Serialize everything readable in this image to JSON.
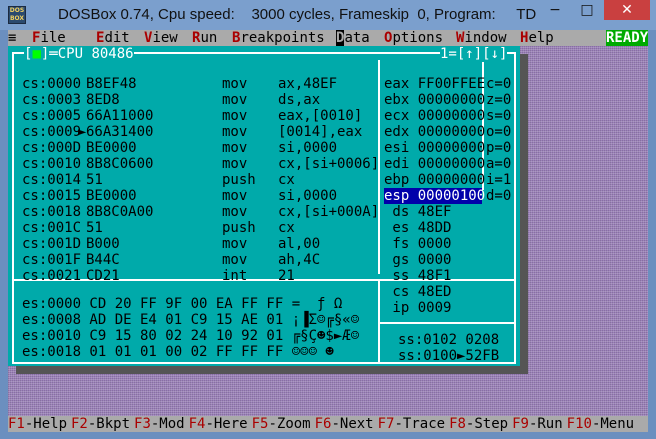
{
  "title": "DOSBox 0.74, Cpu speed:    3000 cycles, Frameskip  0, Program:     TD",
  "app_icon_text": [
    "DOS",
    "BOX"
  ],
  "window_buttons": {
    "minimize": "−",
    "maximize": "□",
    "close": "✕"
  },
  "menu": {
    "system": "≡",
    "items": [
      {
        "hot": "F",
        "rest": "ile"
      },
      {
        "hot": "E",
        "rest": "dit"
      },
      {
        "hot": "V",
        "rest": "iew"
      },
      {
        "hot": "R",
        "rest": "un"
      },
      {
        "hot": "B",
        "rest": "reakpoints"
      },
      {
        "hot": "D",
        "rest": "ata"
      },
      {
        "hot": "O",
        "rest": "ptions"
      },
      {
        "hot": "W",
        "rest": "indow"
      },
      {
        "hot": "H",
        "rest": "elp"
      }
    ],
    "ready": "READY"
  },
  "cpu_window": {
    "title": "CPU 80486",
    "title_marker": "■",
    "right_marker": "1=[↑][↓]",
    "code": [
      {
        "addr": "cs:0000",
        "bytes": "B8EF48",
        "op": "mov",
        "args": "ax,48EF",
        "current": false
      },
      {
        "addr": "cs:0003",
        "bytes": "8ED8",
        "op": "mov",
        "args": "ds,ax",
        "current": false
      },
      {
        "addr": "cs:0005",
        "bytes": "66A11000",
        "op": "mov",
        "args": "eax,[0010]",
        "current": false
      },
      {
        "addr": "cs:0009",
        "bytes": "66A31400",
        "op": "mov",
        "args": "[0014],eax",
        "current": true
      },
      {
        "addr": "cs:000D",
        "bytes": "BE0000",
        "op": "mov",
        "args": "si,0000",
        "current": false
      },
      {
        "addr": "cs:0010",
        "bytes": "8B8C0600",
        "op": "mov",
        "args": "cx,[si+0006]",
        "current": false
      },
      {
        "addr": "cs:0014",
        "bytes": "51",
        "op": "push",
        "args": "cx",
        "current": false
      },
      {
        "addr": "cs:0015",
        "bytes": "BE0000",
        "op": "mov",
        "args": "si,0000",
        "current": false
      },
      {
        "addr": "cs:0018",
        "bytes": "8B8C0A00",
        "op": "mov",
        "args": "cx,[si+000A]",
        "current": false
      },
      {
        "addr": "cs:001C",
        "bytes": "51",
        "op": "push",
        "args": "cx",
        "current": false
      },
      {
        "addr": "cs:001D",
        "bytes": "B000",
        "op": "mov",
        "args": "al,00",
        "current": false
      },
      {
        "addr": "cs:001F",
        "bytes": "B44C",
        "op": "mov",
        "args": "ah,4C",
        "current": false
      },
      {
        "addr": "cs:0021",
        "bytes": "CD21",
        "op": "int",
        "args": "21",
        "current": false
      }
    ],
    "registers": [
      "eax FF00FFEE",
      "ebx 00000000",
      "ecx 00000000",
      "edx 00000000",
      "esi 00000000",
      "edi 00000000",
      "ebp 00000000",
      "esp 00000100",
      " ds 48EF",
      " es 48DD",
      " fs 0000",
      " gs 0000",
      " ss 48F1",
      " cs 48ED",
      " ip 0009"
    ],
    "highlighted_register": 7,
    "flags": [
      "c=0",
      "z=0",
      "s=0",
      "o=0",
      "p=0",
      "a=0",
      "i=1",
      "d=0"
    ],
    "dump": [
      "es:0000 CD 20 FF 9F 00 EA FF FF =  ƒ Ω",
      "es:0008 AD DE E4 01 C9 15 AE 01 ¡▐Σ☺╔§«☺",
      "es:0010 C9 15 80 02 24 10 92 01 ╔§Ç☻$►Æ☺",
      "es:0018 01 01 01 00 02 FF FF FF ☺☺☺ ☻"
    ],
    "stack": [
      "ss:0102 0208",
      "ss:0100►52FB"
    ]
  },
  "status": [
    {
      "key": "F1",
      "label": "-Help"
    },
    {
      "key": "F2",
      "label": "-Bkpt"
    },
    {
      "key": "F3",
      "label": "-Mod"
    },
    {
      "key": "F4",
      "label": "-Here"
    },
    {
      "key": "F5",
      "label": "-Zoom"
    },
    {
      "key": "F6",
      "label": "-Next"
    },
    {
      "key": "F7",
      "label": "-Trace"
    },
    {
      "key": "F8",
      "label": "-Step"
    },
    {
      "key": "F9",
      "label": "-Run"
    },
    {
      "key": "F10",
      "label": "-Menu"
    }
  ]
}
